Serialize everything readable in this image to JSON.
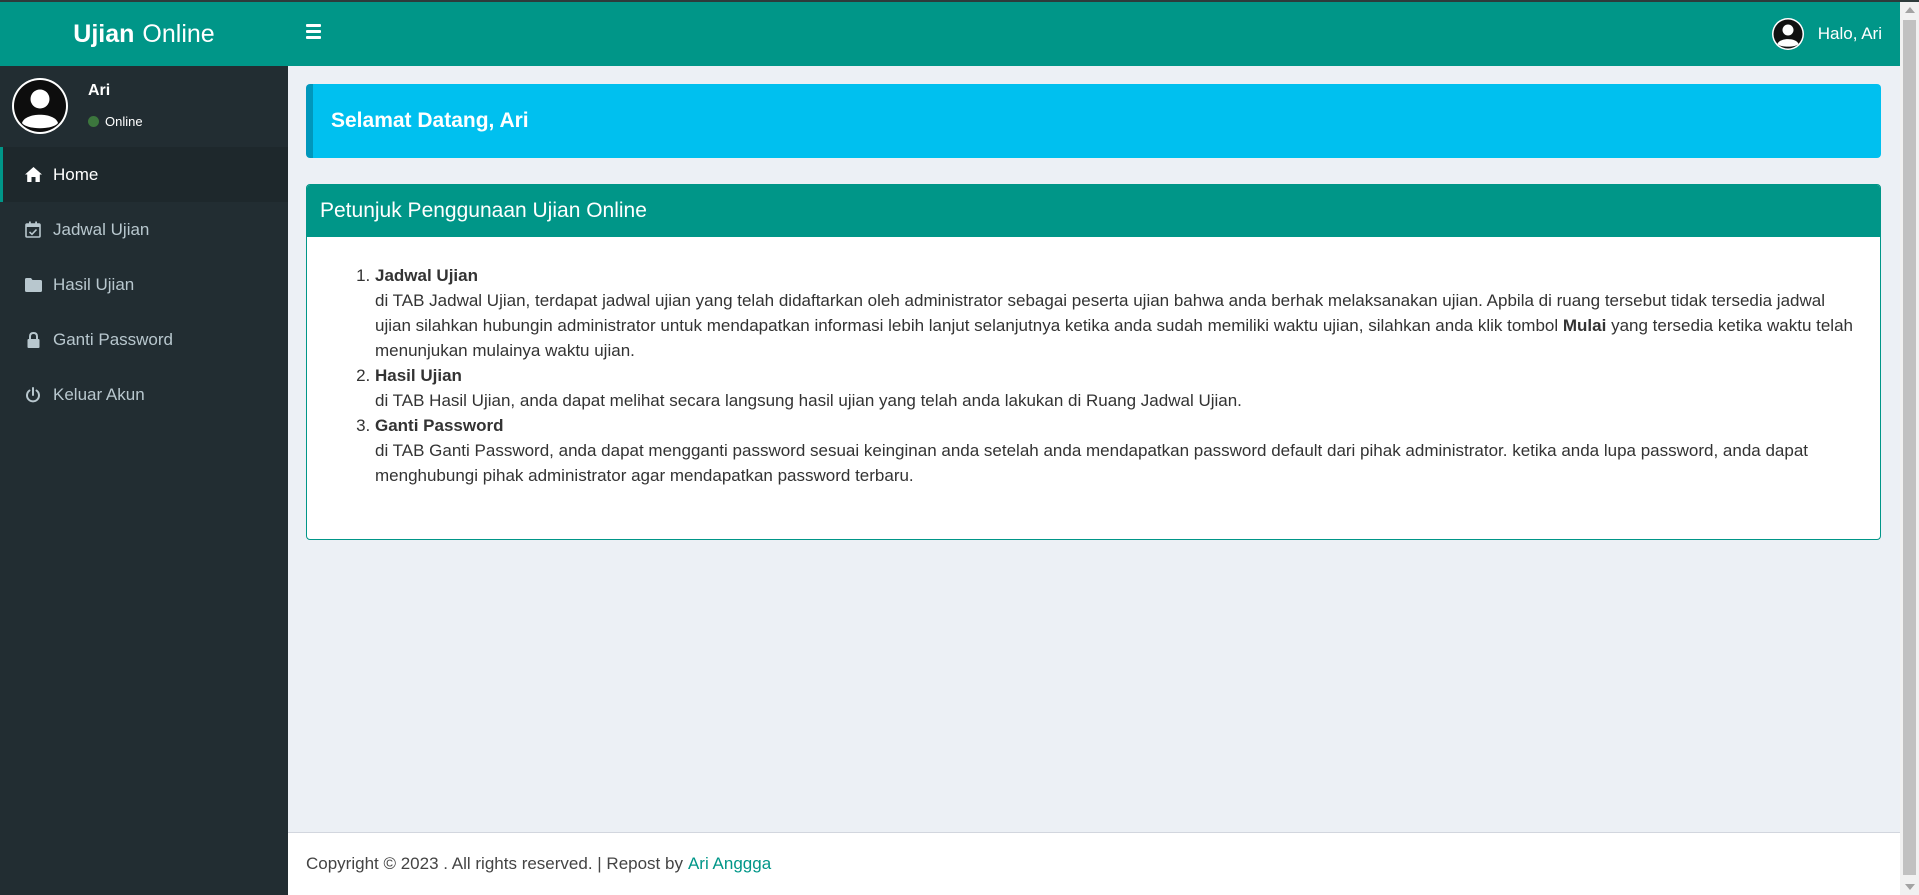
{
  "header": {
    "logo_bold": "Ujian",
    "logo_rest": "Online",
    "user_greeting": "Halo, Ari"
  },
  "sidebar": {
    "user_name": "Ari",
    "user_status": "Online",
    "items": [
      {
        "label": "Home",
        "icon": "home-icon",
        "active": true
      },
      {
        "label": "Jadwal Ujian",
        "icon": "calendar-check-icon",
        "active": false
      },
      {
        "label": "Hasil Ujian",
        "icon": "folder-icon",
        "active": false
      },
      {
        "label": "Ganti Password",
        "icon": "lock-icon",
        "active": false
      },
      {
        "label": "Keluar Akun",
        "icon": "power-icon",
        "active": false
      }
    ]
  },
  "main": {
    "welcome": "Selamat Datang, Ari",
    "guide_title": "Petunjuk Penggunaan Ujian Online",
    "steps": [
      {
        "title": "Jadwal Ujian",
        "text_before": "di TAB Jadwal Ujian, terdapat jadwal ujian yang telah didaftarkan oleh administrator sebagai peserta ujian bahwa anda berhak melaksanakan ujian. Apbila di ruang tersebut tidak tersedia jadwal ujian silahkan hubungin administrator untuk mendapatkan informasi lebih lanjut selanjutnya ketika anda sudah memiliki waktu ujian, silahkan anda klik tombol",
        "text_bold": "Mulai",
        "text_after": "yang tersedia ketika waktu telah menunjukan mulainya waktu ujian."
      },
      {
        "title": "Hasil Ujian",
        "text_before": "di TAB Hasil Ujian, anda dapat melihat secara langsung hasil ujian yang telah anda lakukan di Ruang Jadwal Ujian."
      },
      {
        "title": "Ganti Password",
        "text_before": "di TAB Ganti Password, anda dapat mengganti password sesuai keinginan anda setelah anda mendapatkan password default dari pihak administrator. ketika anda lupa password, anda dapat menghubungi pihak administrator agar mendapatkan password terbaru."
      }
    ]
  },
  "footer": {
    "text": "Copyright © 2023 . All rights reserved. | Repost by",
    "link": "Ari Anggga"
  },
  "colors": {
    "primary": "#009688",
    "sidebar_bg": "#222d32",
    "callout_bg": "#00c0ef",
    "content_bg": "#ecf0f5"
  }
}
